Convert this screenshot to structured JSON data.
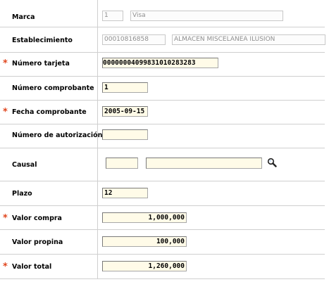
{
  "form": {
    "marca": {
      "label": "Marca",
      "code": "1",
      "name": "Visa"
    },
    "establecimiento": {
      "label": "Establecimiento",
      "code": "00010816858",
      "name": "ALMACEN MISCELANEA ILUSION"
    },
    "numero_tarjeta": {
      "label": "Número tarjeta",
      "value": "0000000409983101028328​3",
      "required": "*"
    },
    "numero_comprobante": {
      "label": "Número comprobante",
      "value": "1"
    },
    "fecha_comprobante": {
      "label": "Fecha comprobante",
      "value": "2005-09-15",
      "required": "*"
    },
    "numero_autorizacion": {
      "label": "Número de autorización",
      "value": ""
    },
    "causal": {
      "label": "Causal",
      "code": "",
      "description": "",
      "icon": "search-icon"
    },
    "plazo": {
      "label": "Plazo",
      "value": "12"
    },
    "valor_compra": {
      "label": "Valor compra",
      "value": "1,000,000",
      "required": "*"
    },
    "valor_propina": {
      "label": "Valor propina",
      "value": "100,000"
    },
    "valor_total": {
      "label": "Valor total",
      "value": "1,260,000",
      "required": "*"
    }
  },
  "colors": {
    "required": "#e0461e",
    "field_bg": "#fffbe8",
    "divider": "#cfcfcf"
  }
}
